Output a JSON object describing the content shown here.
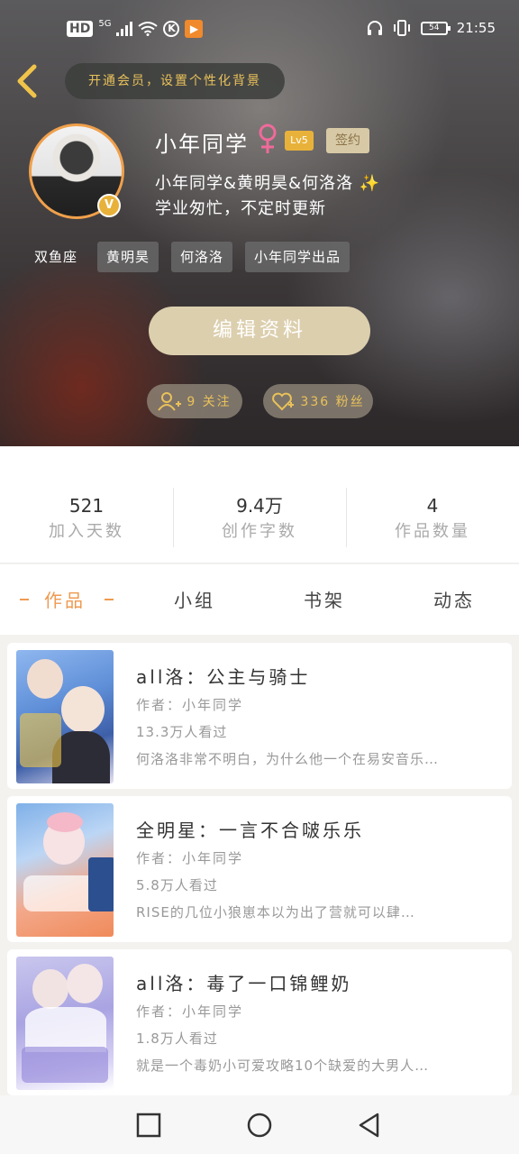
{
  "status_bar": {
    "left_badges": [
      "HD",
      "5G"
    ],
    "k_icon": "K",
    "time": "21:55",
    "battery": "54"
  },
  "header": {
    "vip_pill": "开通会员，设置个性化背景",
    "username": "小年同学",
    "gender_symbol": "♀",
    "level": "Lv5",
    "sign_badge": "签约",
    "verified": "V",
    "bio_line1": "小年同学&黄明昊&何洛洛",
    "bio_sparkle": "✨",
    "bio_line2": "学业匆忙，不定时更新",
    "tags": [
      "双鱼座",
      "黄明昊",
      "何洛洛",
      "小年同学出品"
    ],
    "edit_button": "编辑资料",
    "follow_label": "9 关注",
    "fans_label": "336 粉丝"
  },
  "stats": [
    {
      "value": "521",
      "label": "加入天数"
    },
    {
      "value": "9.4万",
      "label": "创作字数"
    },
    {
      "value": "4",
      "label": "作品数量"
    }
  ],
  "tabs": [
    {
      "label": "作品",
      "active": true
    },
    {
      "label": "小组",
      "active": false
    },
    {
      "label": "书架",
      "active": false
    },
    {
      "label": "动态",
      "active": false
    }
  ],
  "books": [
    {
      "title": "all洛：公主与骑士",
      "author": "作者：小年同学",
      "views": "13.3万人看过",
      "desc": "何洛洛非常不明白，为什么他一个在易安音乐…"
    },
    {
      "title": "全明星：一言不合啵乐乐",
      "author": "作者：小年同学",
      "views": "5.8万人看过",
      "desc": "RISE的几位小狼崽本以为出了营就可以肆…"
    },
    {
      "title": "all洛：毒了一口锦鲤奶",
      "author": "作者：小年同学",
      "views": "1.8万人看过",
      "desc": "就是一个毒奶小可爱攻略10个缺爱的大男人…"
    }
  ],
  "colors": {
    "accent": "#ef9a50",
    "gold": "#e9c15a",
    "edit_button": "#dccfae"
  }
}
